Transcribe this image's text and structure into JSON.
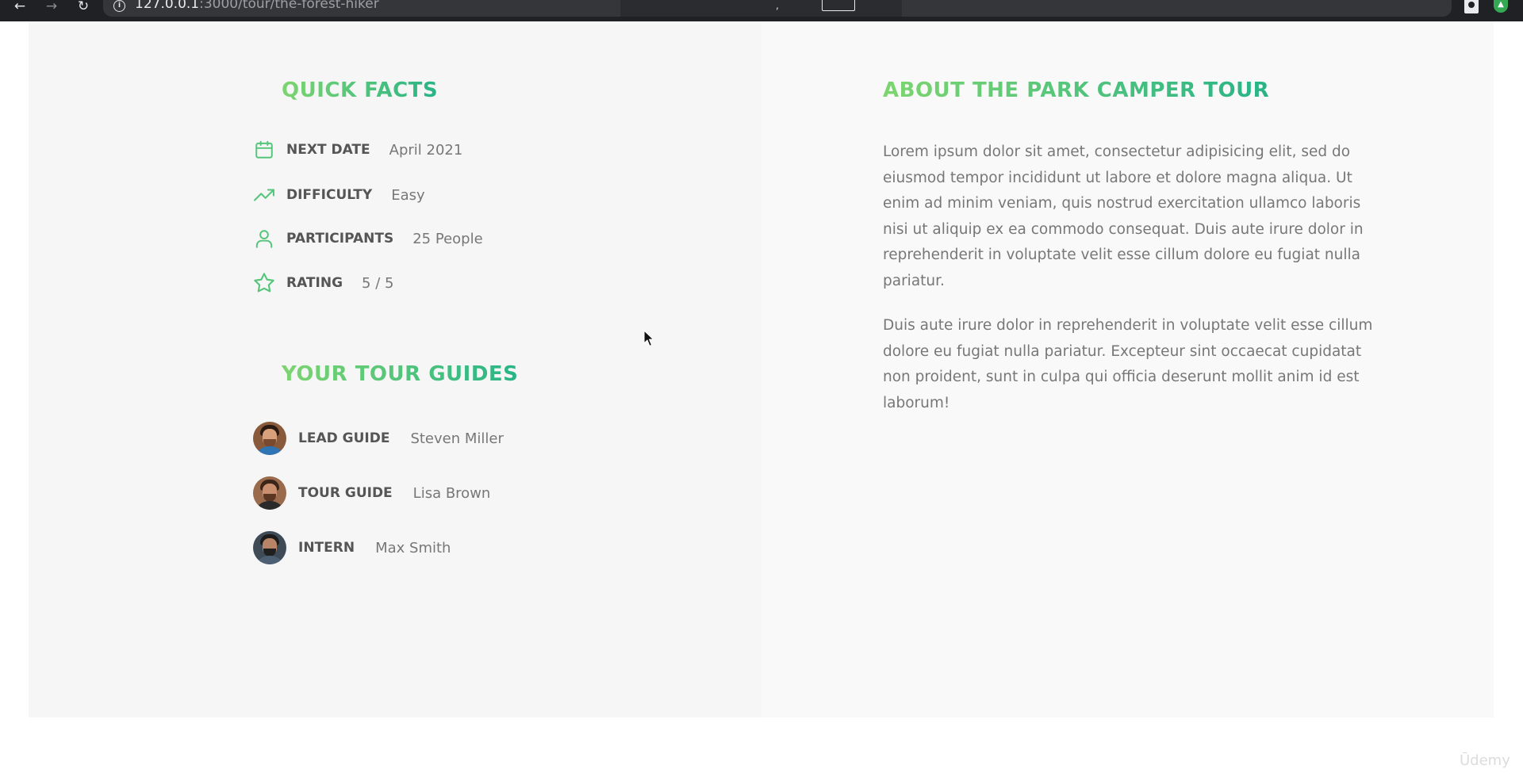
{
  "browser": {
    "url_host": "127.0.0.1",
    "url_rest": ":3000/tour/the-forest-hiker"
  },
  "quick_facts": {
    "title": "Quick facts",
    "items": [
      {
        "icon": "calendar-icon",
        "label": "Next date",
        "value": "April 2021"
      },
      {
        "icon": "trending-up-icon",
        "label": "Difficulty",
        "value": "Easy"
      },
      {
        "icon": "user-icon",
        "label": "Participants",
        "value": "25 People"
      },
      {
        "icon": "star-icon",
        "label": "Rating",
        "value": "5 / 5"
      }
    ]
  },
  "guides": {
    "title": "Your tour guides",
    "items": [
      {
        "label": "Lead guide",
        "name": "Steven Miller"
      },
      {
        "label": "Tour guide",
        "name": "Lisa Brown"
      },
      {
        "label": "Intern",
        "name": "Max Smith"
      }
    ]
  },
  "about": {
    "title": "About the park camper tour",
    "paragraphs": [
      "Lorem ipsum dolor sit amet, consectetur adipisicing elit, sed do eiusmod tempor incididunt ut labore et dolore magna aliqua. Ut enim ad minim veniam, quis nostrud exercitation ullamco laboris nisi ut aliquip ex ea commodo consequat. Duis aute irure dolor in reprehenderit in voluptate velit esse cillum dolore eu fugiat nulla pariatur.",
      "Duis aute irure dolor in reprehenderit in voluptate velit esse cillum dolore eu fugiat nulla pariatur. Excepteur sint occaecat cupidatat non proident, sunt in culpa qui officia deserunt mollit anim id est laborum!"
    ]
  },
  "watermark": "Ūdemy",
  "colors": {
    "accent_light": "#7dd56f",
    "accent_dark": "#28b487",
    "text_label": "#555555",
    "text_value": "#777777"
  }
}
